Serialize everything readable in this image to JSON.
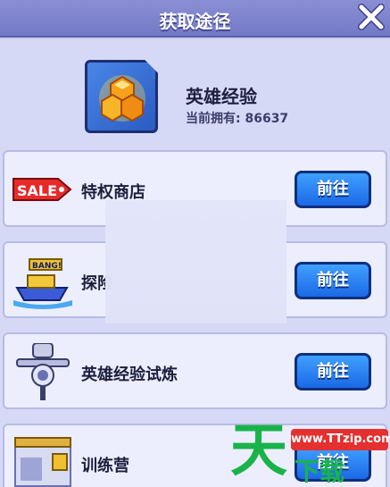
{
  "header": {
    "title": "获取途径"
  },
  "item": {
    "name": "英雄经验",
    "owned": "当前拥有: 86637"
  },
  "sources": [
    {
      "label": "特权商店",
      "button": "前往",
      "icon": "sale-tag-icon"
    },
    {
      "label": "探险",
      "button": "前往",
      "icon": "boat-icon"
    },
    {
      "label": "英雄经验试炼",
      "button": "前往",
      "icon": "training-dummy-icon"
    },
    {
      "label": "训练营",
      "button": "前往",
      "icon": "training-camp-icon"
    }
  ],
  "icons": {
    "sale_tag_text": "SALE",
    "boat_banner_text": "BANG!"
  },
  "watermark": {
    "big": "天",
    "url": "www.TTzip.com",
    "tail": "下载"
  },
  "colors": {
    "header": "#7f84cd",
    "button": "#2a7ef2",
    "accent_green": "#19b34a"
  }
}
